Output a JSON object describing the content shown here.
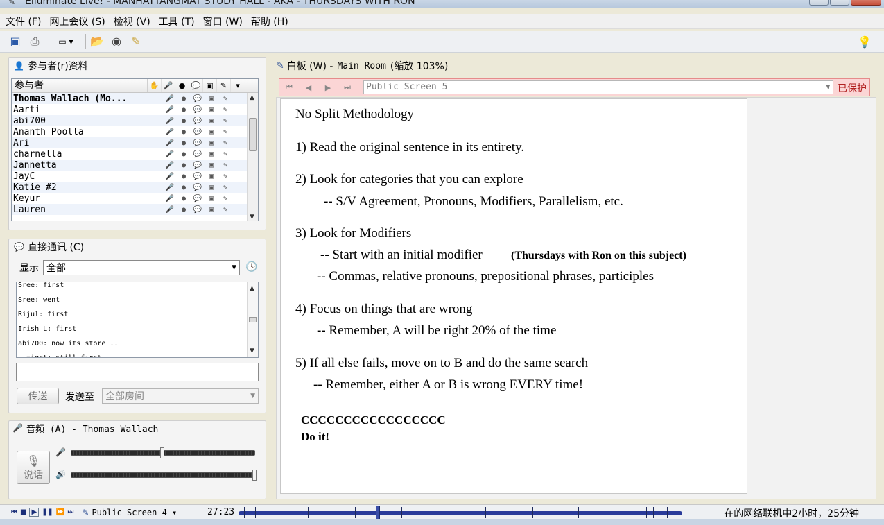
{
  "window": {
    "title": "Elluminate Live! - MANHATTANGMAT STUDY HALL - AKA - THURSDAYS WITH RON"
  },
  "menu": [
    {
      "label": "文件",
      "key": "(F)"
    },
    {
      "label": "网上会议",
      "key": "(S)"
    },
    {
      "label": "检视",
      "key": "(V)"
    },
    {
      "label": "工具",
      "key": "(T)"
    },
    {
      "label": "窗口",
      "key": "(W)"
    },
    {
      "label": "帮助",
      "key": "(H)"
    }
  ],
  "participants_panel": {
    "title": "参与者(r)资料",
    "column_header": "参与者",
    "rows": [
      {
        "name": "Thomas Wallach (Mo...",
        "bold": true
      },
      {
        "name": "Aarti"
      },
      {
        "name": "abi700"
      },
      {
        "name": "Ananth Poolla"
      },
      {
        "name": "Ari"
      },
      {
        "name": "charnella"
      },
      {
        "name": "Jannetta"
      },
      {
        "name": "JayC"
      },
      {
        "name": "Katie #2"
      },
      {
        "name": "Keyur"
      },
      {
        "name": "Lauren"
      }
    ]
  },
  "chat_panel": {
    "title": "直接通讯 (C)",
    "show_label": "显示",
    "filter_value": "全部",
    "messages": [
      "Sree: first",
      "Sree: went",
      "Rijul: first",
      "Irish L: first",
      "abi700: now its store ..",
      "- tight: still first"
    ],
    "send_label": "传送",
    "send_to_label": "发送至",
    "send_to_value": "全部房间"
  },
  "audio_panel": {
    "title": "音频 (A) - Thomas Wallach",
    "talk_label": "说话",
    "mic_level": 0.5,
    "speaker_level": 1.0
  },
  "whiteboard": {
    "header_label": "白板 (W) -",
    "room": "Main Room",
    "zoom": "(缩放 103%)",
    "current_screen": "Public Screen 5",
    "protected_label": "已保护",
    "lines": [
      "No Split Methodology",
      "1) Read the original sentence in its entirety.",
      "2) Look for categories that you can explore",
      "-- S/V Agreement, Pronouns, Modifiers, Parallelism, etc.",
      "3) Look for Modifiers",
      "-- Start with an initial modifier",
      "(Thursdays with Ron on this subject)",
      "-- Commas, relative pronouns, prepositional phrases, participles",
      "4) Focus on things that are wrong",
      "-- Remember, A will be right 20% of the time",
      "5) If all else fails, move on to B and do the same search",
      "-- Remember, either A or B is wrong EVERY time!",
      "CCCCCCCCCCCCCCCCC",
      "Do it!"
    ]
  },
  "statusbar": {
    "screen": "Public Screen 4",
    "time": "27:23",
    "playback_position": 0.31,
    "status_text": "在的网络联机中2小时，25分钟"
  },
  "colors": {
    "accent_blue": "#2a3b9a",
    "protected_bg": "#fbd5d5",
    "protected_text": "#b12020"
  }
}
